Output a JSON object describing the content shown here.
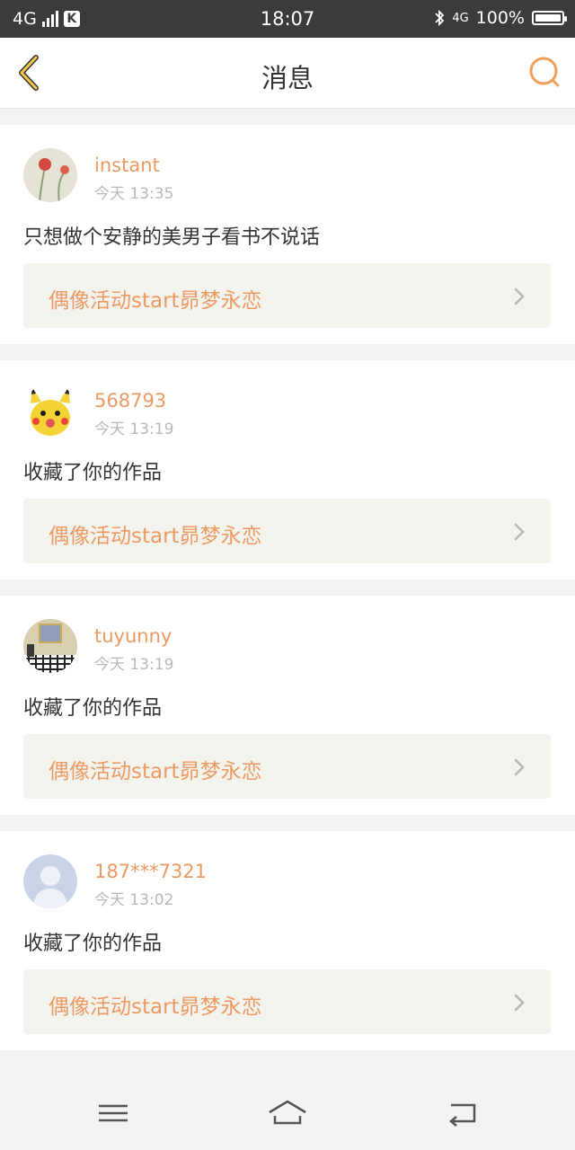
{
  "status_bar": {
    "network": "4G",
    "k_badge": "K",
    "time": "18:07",
    "network_right": "4G",
    "battery_text": "100%"
  },
  "header": {
    "title": "消息",
    "back_icon": "chevron-left-icon",
    "search_icon": "search-icon",
    "accent_color": "#f0a05a"
  },
  "messages": [
    {
      "username": "instant",
      "time": "今天 13:35",
      "text": "只想做个安静的美男子看书不说话",
      "link": "偶像活动start昴梦永恋",
      "avatar": "flower-avatar"
    },
    {
      "username": "568793",
      "time": "今天 13:19",
      "text": "收藏了你的作品",
      "link": "偶像活动start昴梦永恋",
      "avatar": "pikachu-avatar"
    },
    {
      "username": "tuyunny",
      "time": "今天 13:19",
      "text": "收藏了你的作品",
      "link": "偶像活动start昴梦永恋",
      "avatar": "room-avatar"
    },
    {
      "username": "187***7321",
      "time": "今天 13:02",
      "text": "收藏了你的作品",
      "link": "偶像活动start昴梦永恋",
      "avatar": "default-user-avatar"
    }
  ],
  "bottom_nav": {
    "menu_icon": "menu-icon",
    "home_icon": "home-icon",
    "back_icon": "back-icon"
  },
  "colors": {
    "username": "#ec9a63",
    "link_bg": "#f4f4ef",
    "page_bg": "#f4f3f2"
  }
}
